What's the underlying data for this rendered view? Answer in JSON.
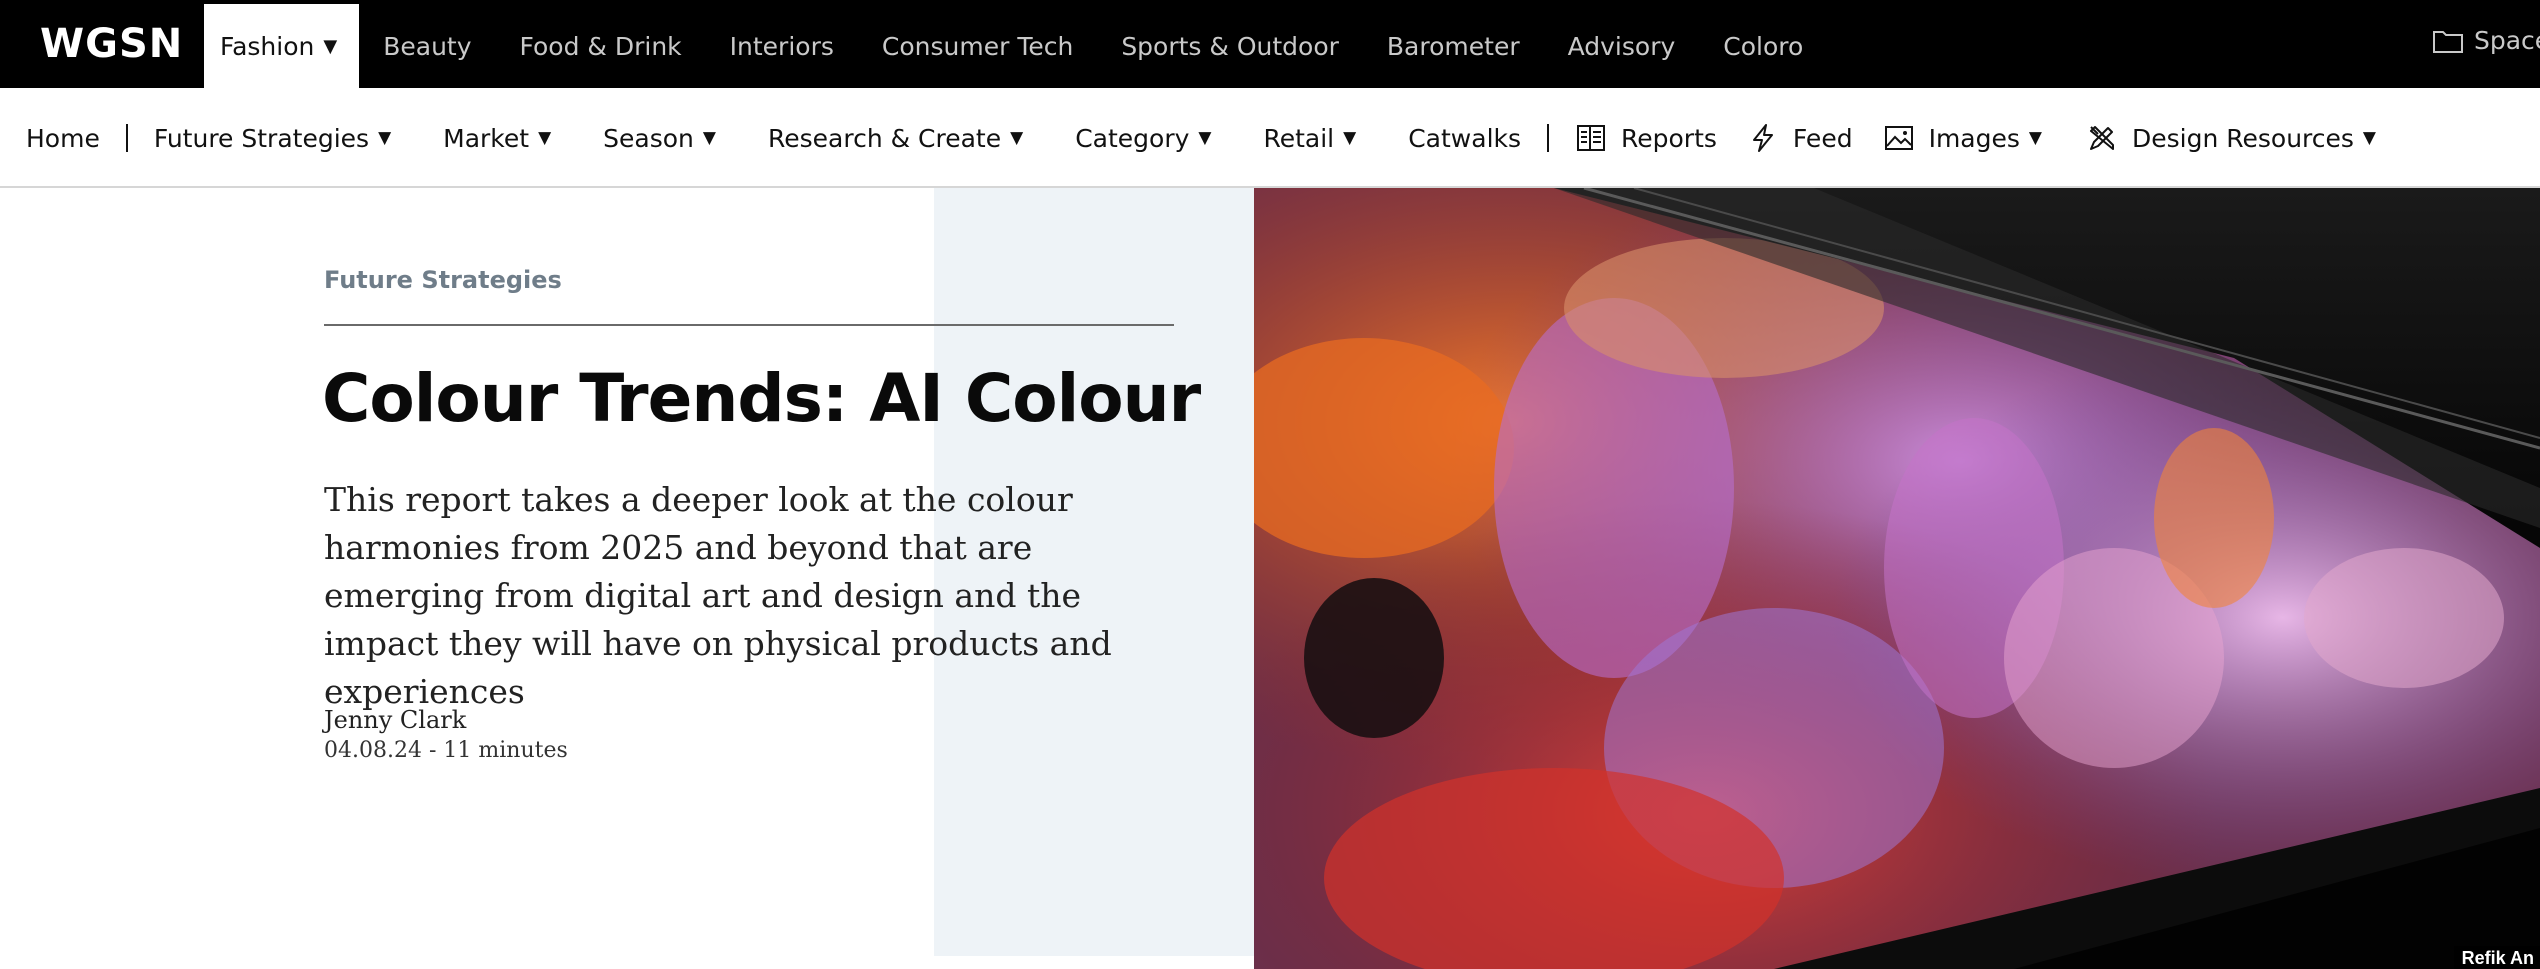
{
  "brand": {
    "logo": "WGSN"
  },
  "topnav": {
    "tabs": [
      {
        "label": "Fashion",
        "active": true
      },
      {
        "label": "Beauty"
      },
      {
        "label": "Food & Drink"
      },
      {
        "label": "Interiors"
      },
      {
        "label": "Consumer Tech"
      },
      {
        "label": "Sports & Outdoor"
      },
      {
        "label": "Barometer"
      },
      {
        "label": "Advisory"
      },
      {
        "label": "Coloro"
      }
    ],
    "spaces_label": "Space"
  },
  "subnav": {
    "items": [
      {
        "label": "Home"
      },
      {
        "label": "Future Strategies",
        "dropdown": true
      },
      {
        "label": "Market",
        "dropdown": true
      },
      {
        "label": "Season",
        "dropdown": true
      },
      {
        "label": "Research & Create",
        "dropdown": true
      },
      {
        "label": "Category",
        "dropdown": true
      },
      {
        "label": "Retail",
        "dropdown": true
      },
      {
        "label": "Catwalks"
      },
      {
        "label": "Reports",
        "icon": "reports-icon"
      },
      {
        "label": "Feed",
        "icon": "lightning-icon"
      },
      {
        "label": "Images",
        "icon": "image-icon",
        "dropdown": true
      },
      {
        "label": "Design Resources",
        "icon": "design-tools-icon",
        "dropdown": true
      }
    ]
  },
  "article": {
    "eyebrow": "Future Strategies",
    "title": "Colour Trends: AI Colour",
    "lede": "This report takes a deeper look at the colour harmonies from 2025 and beyond that are emerging from digital art and design and the impact they will have on physical products and experiences",
    "author": "Jenny Clark",
    "meta": "04.08.24 - 11 minutes",
    "image_credit": "Refik An"
  },
  "colors": {
    "topbar": "#000000",
    "band": "#eef3f7",
    "eyebrow": "#6f7d89"
  }
}
